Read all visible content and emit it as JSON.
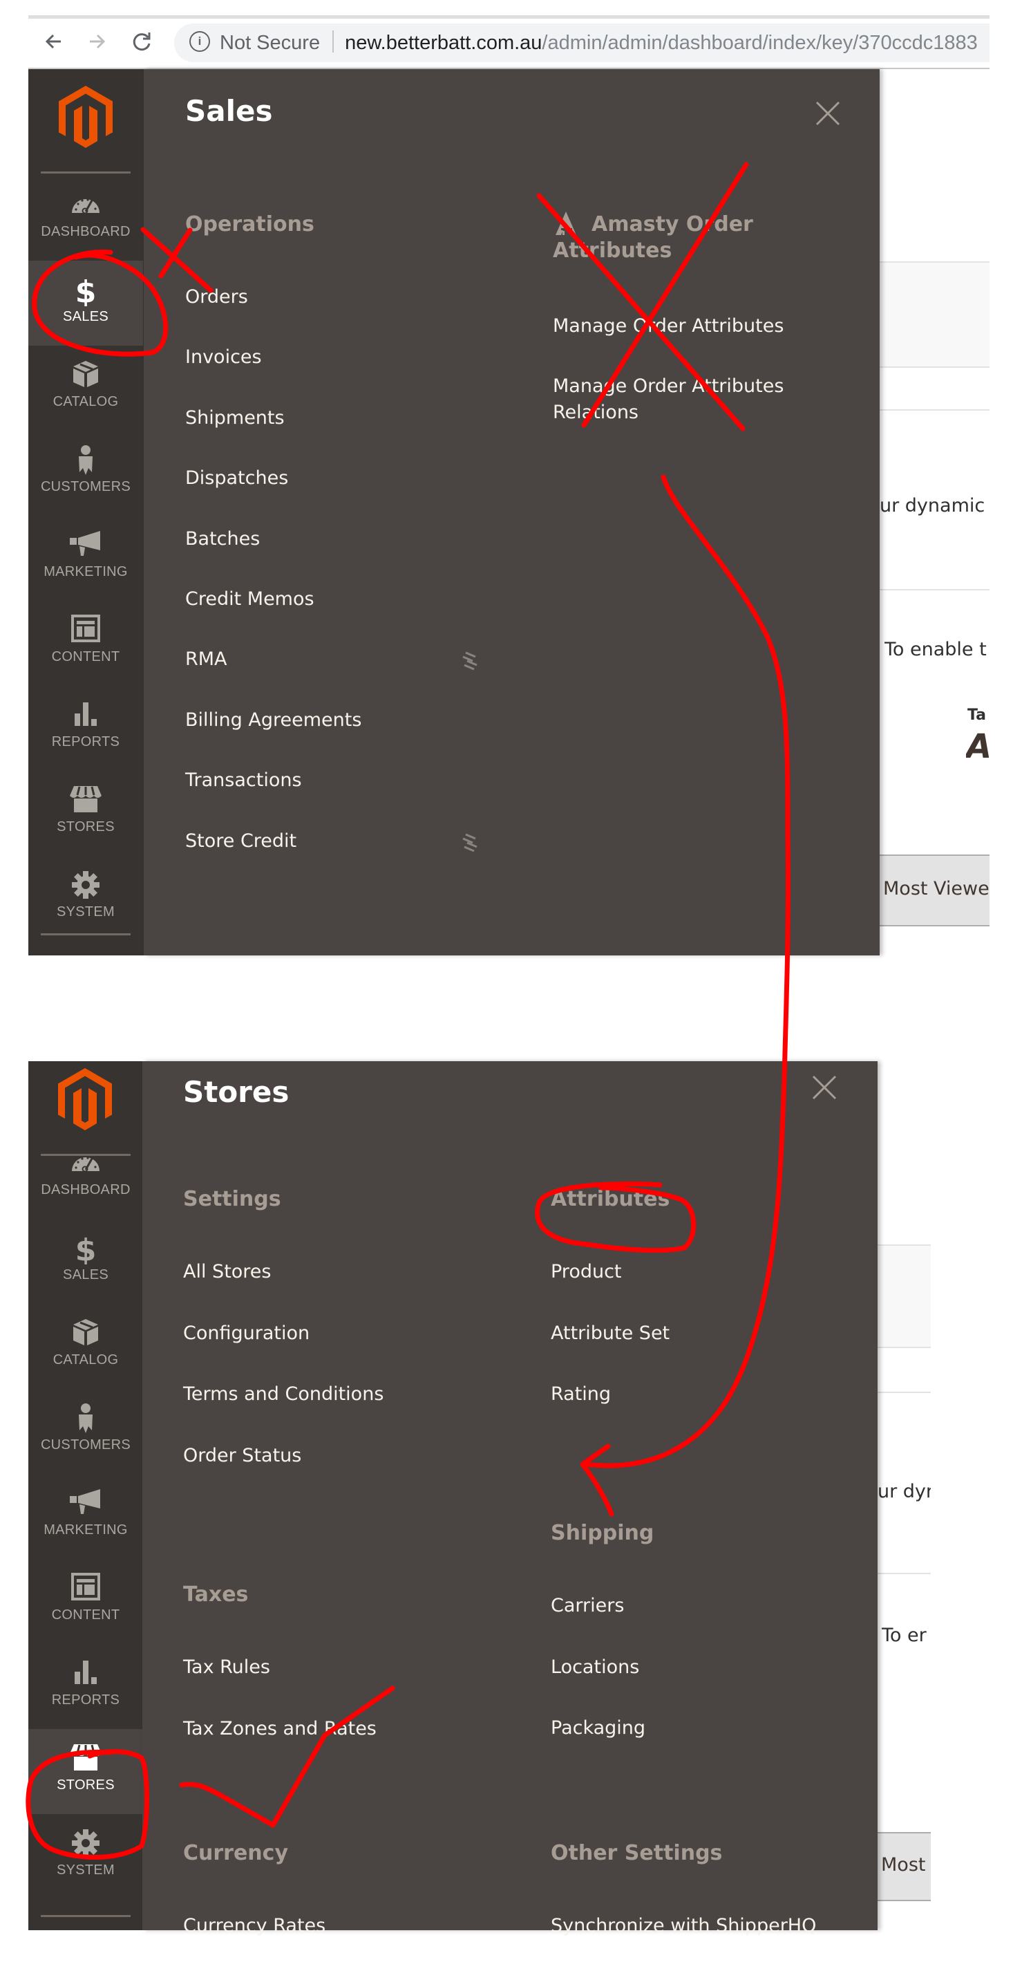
{
  "browser": {
    "security_label": "Not Secure",
    "url_host": "new.betterbatt.com.au",
    "url_path": "/admin/admin/dashboard/index/key/370ccdc1883"
  },
  "sidebar": {
    "items": [
      {
        "label": "DASHBOARD",
        "icon": "dashboard-gauge-icon"
      },
      {
        "label": "SALES",
        "icon": "dollar-icon"
      },
      {
        "label": "CATALOG",
        "icon": "box-icon"
      },
      {
        "label": "CUSTOMERS",
        "icon": "person-icon"
      },
      {
        "label": "MARKETING",
        "icon": "megaphone-icon"
      },
      {
        "label": "CONTENT",
        "icon": "layout-icon"
      },
      {
        "label": "REPORTS",
        "icon": "bar-chart-icon"
      },
      {
        "label": "STORES",
        "icon": "storefront-icon"
      },
      {
        "label": "SYSTEM",
        "icon": "gear-icon"
      }
    ]
  },
  "sales_menu": {
    "title": "Sales",
    "active_item": "SALES",
    "operations": {
      "heading": "Operations",
      "items": [
        "Orders",
        "Invoices",
        "Shipments",
        "Dispatches",
        "Batches",
        "Credit Memos",
        "RMA",
        "Billing Agreements",
        "Transactions",
        "Store Credit"
      ],
      "enterprise_marked": [
        "RMA",
        "Store Credit"
      ]
    },
    "amasty": {
      "heading": "Amasty Order Attributes",
      "items": [
        "Manage Order Attributes",
        "Manage Order Attributes Relations"
      ]
    }
  },
  "stores_menu": {
    "title": "Stores",
    "active_item": "STORES",
    "settings": {
      "heading": "Settings",
      "items": [
        "All Stores",
        "Configuration",
        "Terms and Conditions",
        "Order Status"
      ]
    },
    "taxes": {
      "heading": "Taxes",
      "items": [
        "Tax Rules",
        "Tax Zones and Rates"
      ]
    },
    "currency": {
      "heading": "Currency",
      "items": [
        "Currency Rates"
      ]
    },
    "attributes": {
      "heading": "Attributes",
      "items": [
        "Product",
        "Attribute Set",
        "Rating"
      ]
    },
    "shipping": {
      "heading": "Shipping",
      "items": [
        "Carriers",
        "Locations",
        "Packaging"
      ]
    },
    "other": {
      "heading": "Other Settings",
      "items": [
        "Synchronize with ShipperHQ"
      ]
    }
  },
  "background_page": {
    "top": {
      "text_1": "ur dynamic p",
      "text_2": "To enable t",
      "label_small": "Ta",
      "label_big": "A",
      "tab": "Most Viewe"
    },
    "bottom": {
      "text_1": "ur dyr",
      "text_2": "To er",
      "tab": "Most"
    }
  },
  "annotations": {
    "color": "#ff0000",
    "marks": [
      "x-over-dashboard-sales",
      "circle-sales",
      "x-over-amasty",
      "curve-arrow-to-attributes",
      "circle-attributes",
      "checkmark-taxes",
      "circle-stores"
    ]
  },
  "colors": {
    "sidebar_bg": "#373330",
    "panel_bg": "#4a4542",
    "logo_orange": "#eb5202",
    "heading_gray": "#a79d95",
    "link_white": "#f7f3eb"
  }
}
